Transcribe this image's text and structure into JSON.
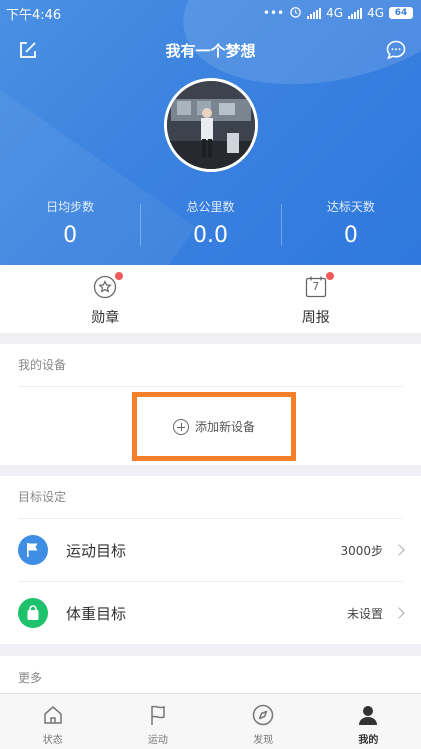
{
  "status_bar": {
    "time": "下午4:46",
    "signal_1": "4G",
    "signal_2": "4G",
    "battery": "64",
    "icons": [
      "dots-icon",
      "alarm-icon",
      "signal-icon",
      "battery-icon"
    ]
  },
  "header": {
    "title": "我有一个梦想",
    "left_icon": "edit-icon",
    "right_icon": "message-icon",
    "accent": "#3b82e0"
  },
  "stats": [
    {
      "label": "日均步数",
      "value": "0"
    },
    {
      "label": "总公里数",
      "value": "0.0"
    },
    {
      "label": "达标天数",
      "value": "0"
    }
  ],
  "quick_actions": [
    {
      "label": "勋章",
      "icon": "medal-icon",
      "badge": true
    },
    {
      "label": "周报",
      "icon": "calendar-icon",
      "icon_text": "7",
      "badge": true
    }
  ],
  "devices": {
    "section_title": "我的设备",
    "add_label": "添加新设备",
    "highlight_color": "#f5802a"
  },
  "goals": {
    "section_title": "目标设定",
    "items": [
      {
        "label": "运动目标",
        "value": "3000步",
        "icon": "flag-icon",
        "color": "#3f8ee6"
      },
      {
        "label": "体重目标",
        "value": "未设置",
        "icon": "bag-icon",
        "color": "#1ec26c"
      }
    ]
  },
  "more": {
    "section_title": "更多"
  },
  "tabs": [
    {
      "label": "状态",
      "icon": "home-icon",
      "active": false
    },
    {
      "label": "运动",
      "icon": "flag-outline-icon",
      "active": false
    },
    {
      "label": "发现",
      "icon": "compass-icon",
      "active": false
    },
    {
      "label": "我的",
      "icon": "person-icon",
      "active": true
    }
  ]
}
